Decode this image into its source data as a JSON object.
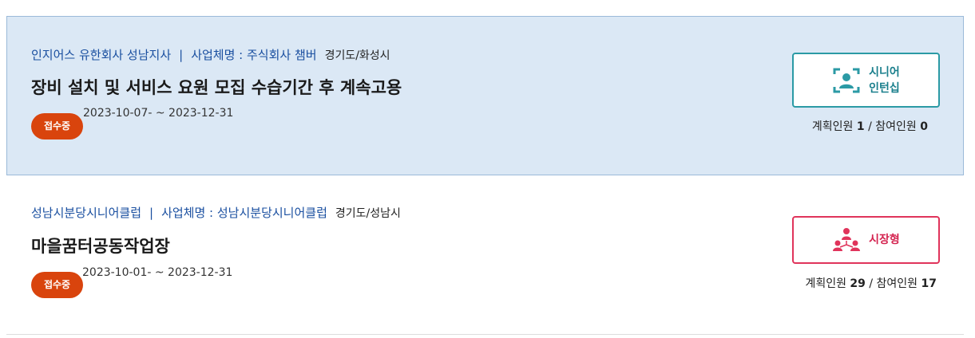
{
  "items": [
    {
      "org": "인지어스 유한회사 성남지사",
      "separator": "|",
      "business_name": "사업체명 : 주식회사 챔버",
      "region": "경기도/화성시",
      "title": "장비 설치 및 서비스 요원 모집 수습기간 후 계속고용",
      "period": "2023-10-07- ~ 2023-12-31",
      "status": "접수중",
      "type_label": "시니어\n인턴십",
      "type_icon": "senior-intern-icon",
      "planned_label": "계획인원",
      "planned": "1",
      "count_sep": "/",
      "joined_label": "참여인원",
      "joined": "0",
      "accent": "#2b9aa5"
    },
    {
      "org": "성남시분당시니어클럽",
      "separator": "|",
      "business_name": "사업체명 : 성남시분당시니어클럽",
      "region": "경기도/성남시",
      "title": "마을꿈터공동작업장",
      "period": "2023-10-01- ~ 2023-12-31",
      "status": "접수중",
      "type_label": "시장형",
      "type_icon": "market-type-icon",
      "planned_label": "계획인원",
      "planned": "29",
      "count_sep": "/",
      "joined_label": "참여인원",
      "joined": "17",
      "accent": "#e0345b"
    }
  ],
  "colors": {
    "highlight_bg": "#dbe8f5",
    "link_blue": "#1a4fa0",
    "badge_orange": "#d9440d"
  }
}
